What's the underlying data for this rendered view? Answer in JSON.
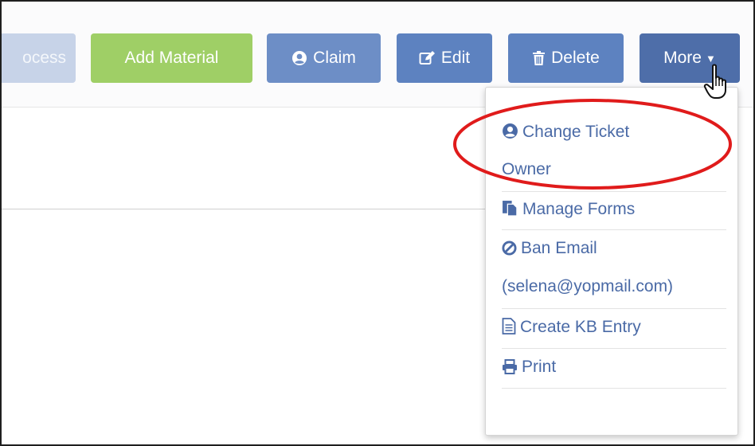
{
  "toolbar": {
    "process_label": "ocess",
    "add_material_label": "Add Material",
    "claim_label": "Claim",
    "edit_label": "Edit",
    "delete_label": "Delete",
    "more_label": "More"
  },
  "more_menu": {
    "items": [
      {
        "line1": "Change Ticket",
        "line2": "Owner",
        "icon": "user-circle-icon"
      },
      {
        "line1": "Manage Forms",
        "icon": "forms-icon"
      },
      {
        "line1": "Ban Email",
        "line2": "(selena@yopmail.com)",
        "icon": "ban-icon"
      },
      {
        "line1": "Create KB Entry",
        "icon": "document-icon"
      },
      {
        "line1": "Print",
        "icon": "print-icon"
      }
    ]
  },
  "colors": {
    "add_material": "#9fcf66",
    "primary": "#5d82c0",
    "more": "#4e6ea9",
    "menu_text": "#4a6aa6",
    "annotation": "#e01b1b"
  }
}
